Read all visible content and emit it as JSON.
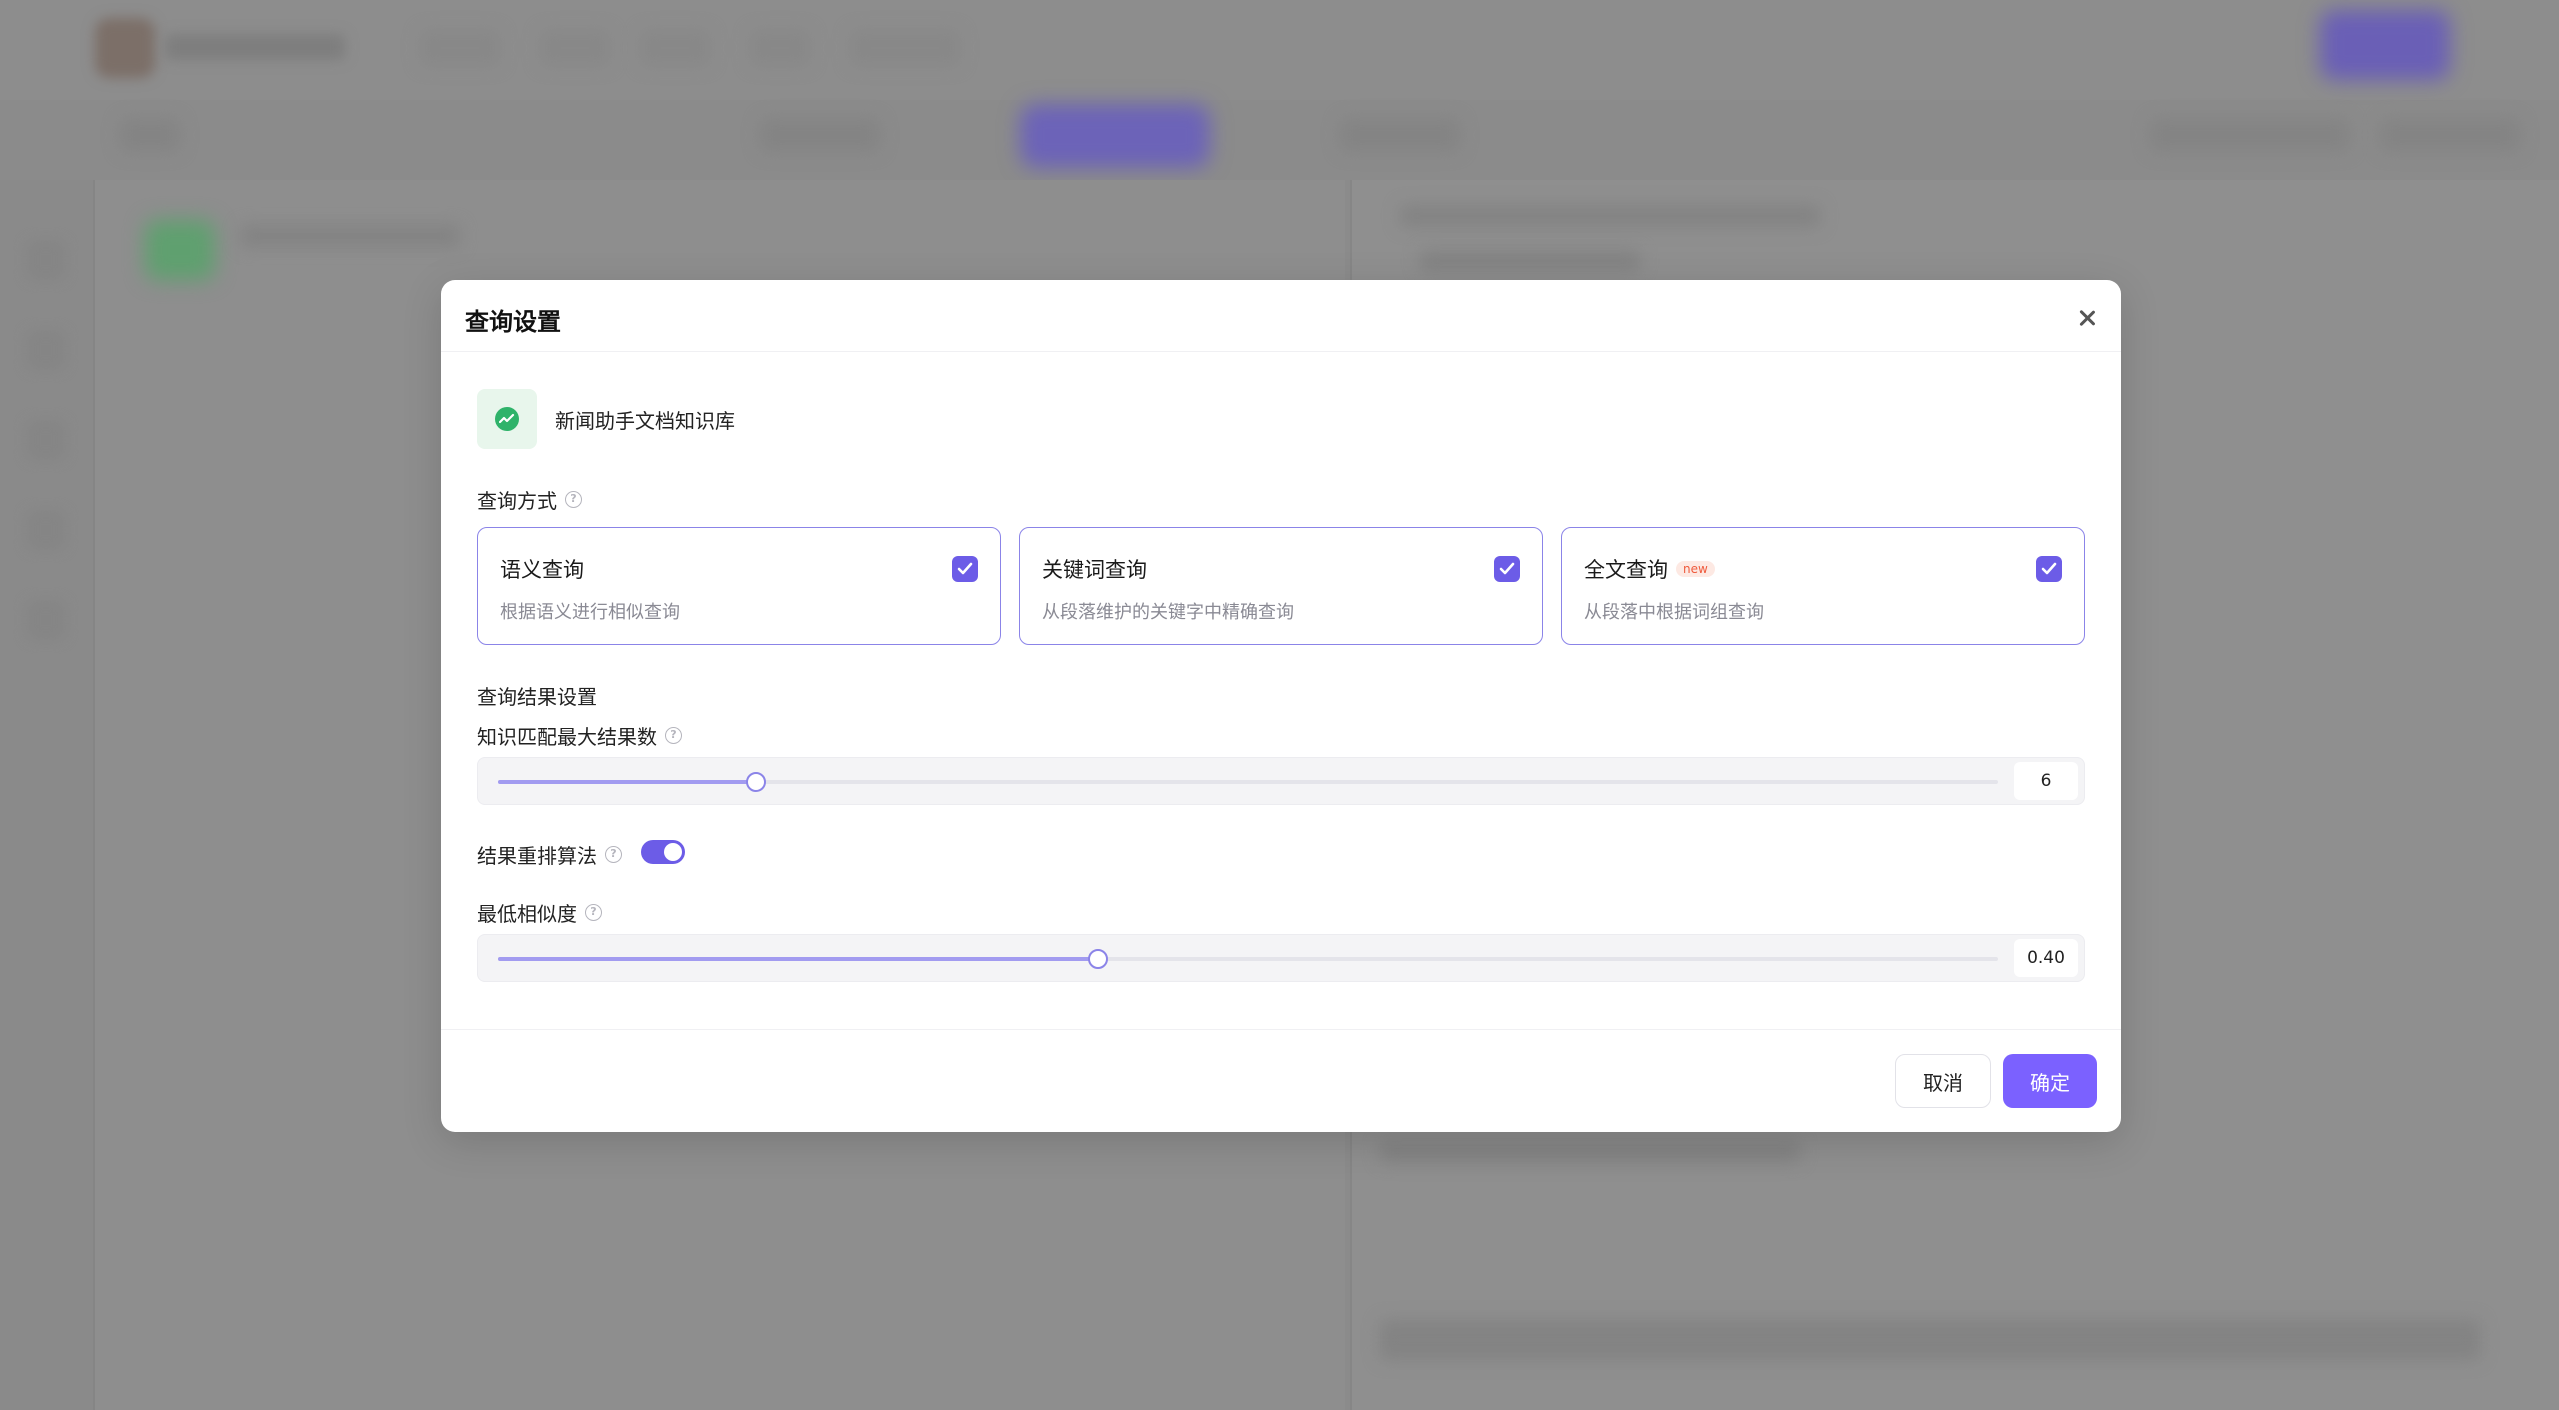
{
  "modal": {
    "title": "查询设置",
    "knowledge_base": {
      "name": "新闻助手文档知识库",
      "icon": "trend-chart-icon",
      "icon_color": "#2fb36a"
    },
    "query_mode": {
      "label": "查询方式",
      "options": [
        {
          "title": "语义查询",
          "description": "根据语义进行相似查询",
          "checked": true
        },
        {
          "title": "关键词查询",
          "description": "从段落维护的关键字中精确查询",
          "checked": true
        },
        {
          "title": "全文查询",
          "description": "从段落中根据词组查询",
          "checked": true,
          "badge": "new"
        }
      ]
    },
    "result_settings": {
      "label": "查询结果设置",
      "max_results": {
        "label": "知识匹配最大结果数",
        "value": "6",
        "fraction": 0.172
      },
      "rerank": {
        "label": "结果重排算法",
        "enabled": true
      },
      "min_similarity": {
        "label": "最低相似度",
        "value": "0.40",
        "fraction": 0.4
      }
    },
    "footer": {
      "cancel_label": "取消",
      "ok_label": "确定"
    },
    "accent_color": "#7b61ff"
  }
}
